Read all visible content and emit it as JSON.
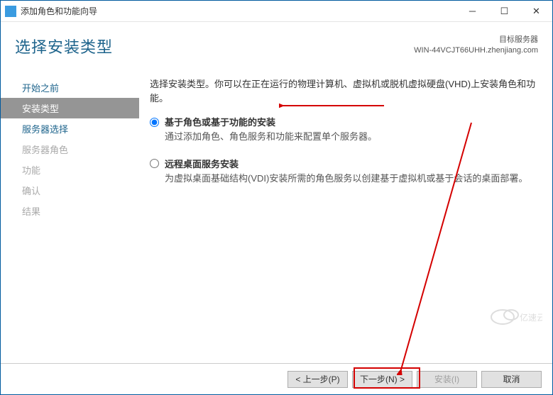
{
  "titlebar": {
    "text": "添加角色和功能向导"
  },
  "header": {
    "title": "选择安装类型",
    "target_label": "目标服务器",
    "target_server": "WIN-44VCJT66UHH.zhenjiang.com"
  },
  "sidebar": {
    "items": [
      {
        "label": "开始之前",
        "state": "enabled"
      },
      {
        "label": "安装类型",
        "state": "selected"
      },
      {
        "label": "服务器选择",
        "state": "enabled"
      },
      {
        "label": "服务器角色",
        "state": "disabled"
      },
      {
        "label": "功能",
        "state": "disabled"
      },
      {
        "label": "确认",
        "state": "disabled"
      },
      {
        "label": "结果",
        "state": "disabled"
      }
    ]
  },
  "main": {
    "instruction": "选择安装类型。你可以在正在运行的物理计算机、虚拟机或脱机虚拟硬盘(VHD)上安装角色和功能。",
    "options": [
      {
        "label": "基于角色或基于功能的安装",
        "desc": "通过添加角色、角色服务和功能来配置单个服务器。",
        "checked": true
      },
      {
        "label": "远程桌面服务安装",
        "desc": "为虚拟桌面基础结构(VDI)安装所需的角色服务以创建基于虚拟机或基于会话的桌面部署。",
        "checked": false
      }
    ]
  },
  "footer": {
    "prev": "< 上一步(P)",
    "next": "下一步(N) >",
    "install": "安装(I)",
    "cancel": "取消"
  },
  "watermark": {
    "text": "亿速云"
  }
}
